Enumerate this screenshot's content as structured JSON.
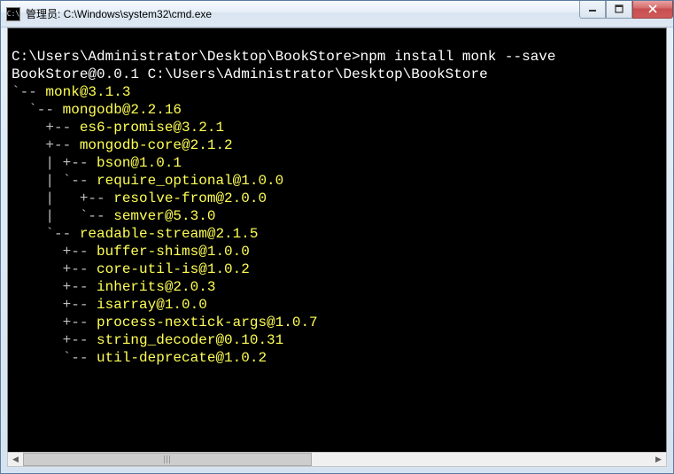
{
  "window": {
    "icon_text": "C:\\",
    "title": "管理员: C:\\Windows\\system32\\cmd.exe"
  },
  "terminal": {
    "blank0": "",
    "prompt_path": "C:\\Users\\Administrator\\Desktop\\BookStore>",
    "command": "npm install monk --save",
    "line2": "BookStore@0.0.1 C:\\Users\\Administrator\\Desktop\\BookStore",
    "t1a": "`-- ",
    "p1": "monk@3.1.3",
    "t2a": "  `-- ",
    "p2": "mongodb@2.2.16",
    "t3a": "    +-- ",
    "p3": "es6-promise@3.2.1",
    "t4a": "    +-- ",
    "p4": "mongodb-core@2.1.2",
    "t5a": "    | +-- ",
    "p5": "bson@1.0.1",
    "t6a": "    | `-- ",
    "p6": "require_optional@1.0.0",
    "t7a": "    |   +-- ",
    "p7": "resolve-from@2.0.0",
    "t8a": "    |   `-- ",
    "p8": "semver@5.3.0",
    "t9a": "    `-- ",
    "p9": "readable-stream@2.1.5",
    "t10a": "      +-- ",
    "p10": "buffer-shims@1.0.0",
    "t11a": "      +-- ",
    "p11": "core-util-is@1.0.2",
    "t12a": "      +-- ",
    "p12": "inherits@2.0.3",
    "t13a": "      +-- ",
    "p13": "isarray@1.0.0",
    "t14a": "      +-- ",
    "p14": "process-nextick-args@1.0.7",
    "t15a": "      +-- ",
    "p15": "string_decoder@0.10.31",
    "t16a": "      `-- ",
    "p16": "util-deprecate@1.0.2"
  }
}
